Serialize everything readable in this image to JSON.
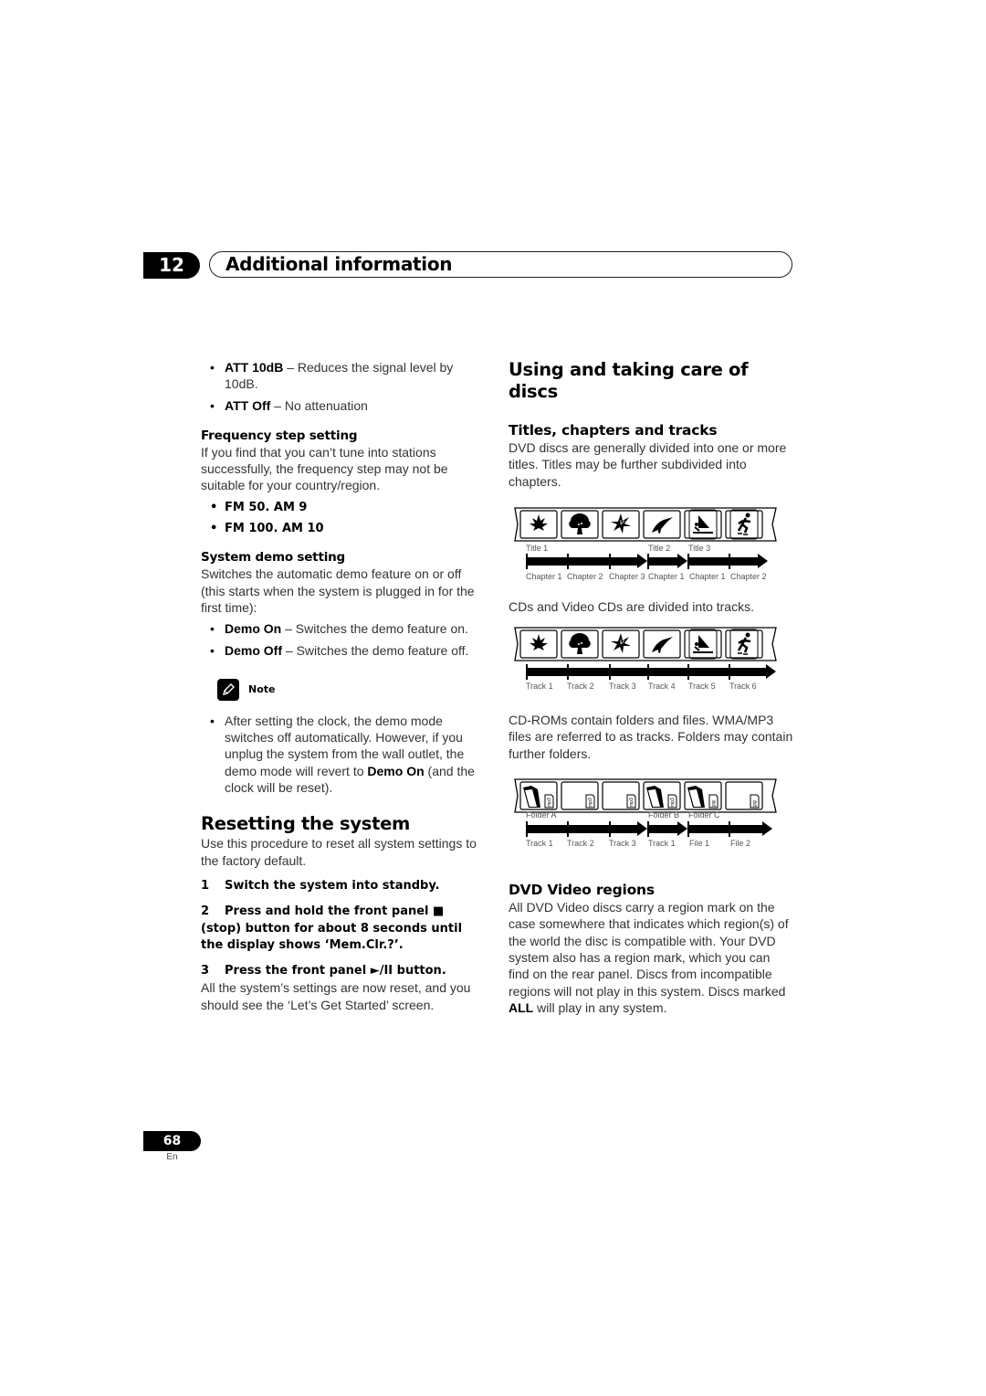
{
  "chapter": {
    "number": "12",
    "title": "Additional information"
  },
  "left": {
    "att_bullets": [
      {
        "bold": "ATT 10dB",
        "text": " – Reduces the signal level by 10dB."
      },
      {
        "bold": "ATT Off",
        "text": " – No attenuation"
      }
    ],
    "freq": {
      "heading": "Frequency step setting",
      "body": "If you find that you can’t tune into stations successfully, the frequency step may not be suitable for your country/region.",
      "options": [
        "FM 50. AM 9",
        "FM 100. AM 10"
      ]
    },
    "demo": {
      "heading": "System demo setting",
      "body": "Switches the automatic demo feature on or off (this starts when the system is plugged in for the first time):",
      "bullets": [
        {
          "bold": "Demo On",
          "text": " – Switches the demo feature on."
        },
        {
          "bold": "Demo Off",
          "text": " – Switches the demo feature off."
        }
      ]
    },
    "note": {
      "label": "Note",
      "icon": "pencil-icon",
      "text_before": "After setting the clock, the demo mode switches off automatically. However, if you unplug the system from the wall outlet, the demo mode will revert to ",
      "bold": "Demo On",
      "text_after": " (and the clock will be reset)."
    },
    "reset": {
      "heading": "Resetting the system",
      "intro": "Use this procedure to reset all system settings to the factory default.",
      "steps": [
        {
          "num": "1",
          "text": "Switch the system into standby."
        },
        {
          "num": "2",
          "text": "Press and hold the front panel ■ (stop) button for about 8 seconds until the display shows ‘Mem.Clr.?’."
        },
        {
          "num": "3",
          "text": "Press the front panel ►/II button."
        }
      ],
      "outro": "All the system’s settings are now reset, and you should see the ‘Let’s Get Started’ screen."
    }
  },
  "right": {
    "heading": "Using and taking care of discs",
    "titles": {
      "heading": "Titles, chapters and tracks",
      "dvd_body": "DVD discs are generally divided into one or more titles. Titles may be further subdivided into chapters.",
      "dvd_diagram": {
        "frames": [
          "leaf-icon",
          "tree-icon",
          "lily-icon",
          "toucan-icon",
          "windsurfer-icon",
          "skater-icon"
        ],
        "top_labels": [
          "Title 1",
          "Title 2",
          "Title 3"
        ],
        "bottom_labels": [
          "Chapter 1",
          "Chapter 2",
          "Chapter 3",
          "Chapter 1",
          "Chapter 1",
          "Chapter 2"
        ]
      },
      "cd_body": "CDs and Video CDs are divided into tracks.",
      "cd_diagram": {
        "frames": [
          "leaf-icon",
          "tree-icon",
          "lily-icon",
          "toucan-icon",
          "windsurfer-icon",
          "skater-icon"
        ],
        "bottom_labels": [
          "Track 1",
          "Track 2",
          "Track 3",
          "Track 4",
          "Track 5",
          "Track 6"
        ]
      },
      "rom_body": "CD-ROMs contain folders and files. WMA/MP3 files are referred to as tracks. Folders may contain further folders.",
      "rom_diagram": {
        "file_types": [
          "mp3",
          "mp3",
          "mp3",
          "mp3",
          "jpg",
          "jpg"
        ],
        "top_labels": [
          "Folder A",
          "Folder B",
          "Folder C"
        ],
        "bottom_labels": [
          "Track 1",
          "Track 2",
          "Track 3",
          "Track 1",
          "File 1",
          "File 2"
        ]
      }
    },
    "regions": {
      "heading": "DVD Video regions",
      "body_before": "All DVD Video discs carry a region mark on the case somewhere that indicates which region(s) of the world the disc is compatible with. Your DVD system also has a region mark, which you can find on the rear panel. Discs from incompatible regions will not play in this system. Discs marked ",
      "bold": "ALL",
      "body_after": " will play in any system."
    }
  },
  "footer": {
    "page": "68",
    "lang": "En"
  }
}
